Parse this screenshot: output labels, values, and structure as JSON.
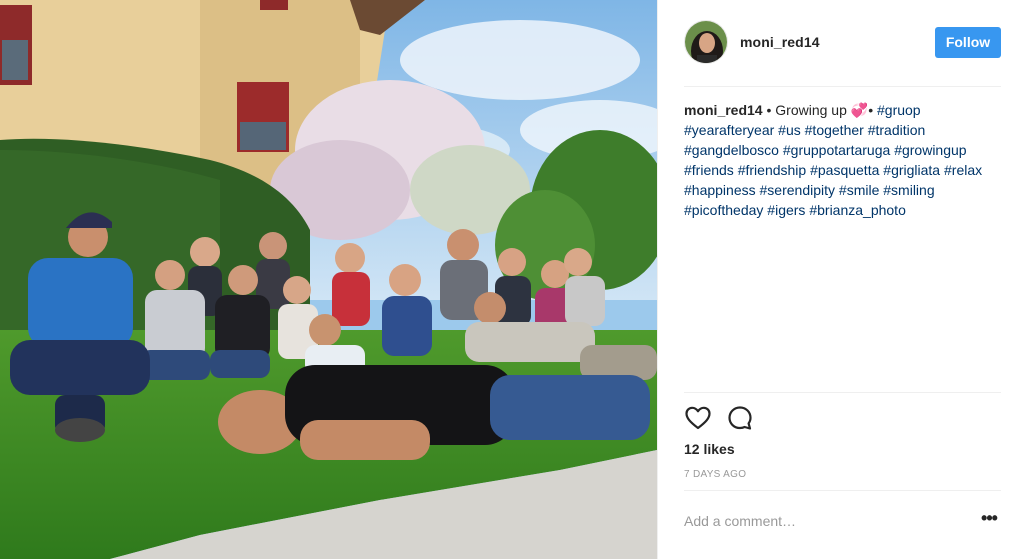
{
  "post": {
    "username": "moni_red14",
    "follow_label": "Follow",
    "caption": {
      "author": "moni_red14",
      "text_before_emoji": " • Growing up ",
      "emoji": "💞•",
      "hashtags": [
        "#gruop",
        "#yearafteryear",
        "#us",
        "#together",
        "#tradition",
        "#gangdelbosco",
        "#gruppotartaruga",
        "#growingup",
        "#friends",
        "#friendship",
        "#pasquetta",
        "#grigliata",
        "#relax",
        "#happiness",
        "#serendipity",
        "#smile",
        "#smiling",
        "#picoftheday",
        "#igers",
        "#brianza_photo"
      ]
    },
    "likes": "12 likes",
    "timestamp": "7 DAYS AGO",
    "comment_placeholder": "Add a comment…",
    "more_label": "•••"
  },
  "icons": {
    "like": "heart-icon",
    "comment": "comment-icon",
    "more": "more-options-icon"
  },
  "colors": {
    "follow_button": "#3897f0",
    "hashtag": "#003569",
    "muted": "#999999"
  }
}
